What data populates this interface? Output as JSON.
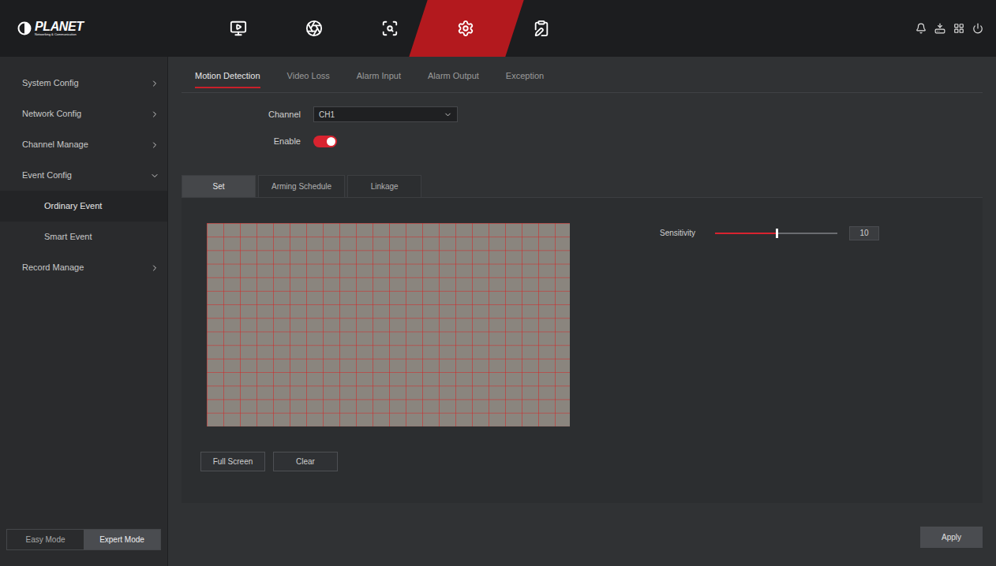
{
  "logo": {
    "name": "PLANET",
    "tagline": "Networking & Communication"
  },
  "top_nav": [
    {
      "kind": "playback",
      "selected": false
    },
    {
      "kind": "ptz",
      "selected": false
    },
    {
      "kind": "search",
      "selected": false
    },
    {
      "kind": "settings",
      "selected": true
    },
    {
      "kind": "maintenance",
      "selected": false
    }
  ],
  "top_actions": [
    {
      "kind": "alarm"
    },
    {
      "kind": "backup"
    },
    {
      "kind": "layout"
    },
    {
      "kind": "power"
    }
  ],
  "sidebar": {
    "items": [
      {
        "label": "System Config",
        "kind": "group",
        "expanded": false,
        "selected": false
      },
      {
        "label": "Network Config",
        "kind": "group",
        "expanded": false,
        "selected": false
      },
      {
        "label": "Channel Manage",
        "kind": "group",
        "expanded": false,
        "selected": false
      },
      {
        "label": "Event Config",
        "kind": "group",
        "expanded": true,
        "selected": false
      },
      {
        "label": "Ordinary Event",
        "kind": "child",
        "expanded": false,
        "selected": true
      },
      {
        "label": "Smart Event",
        "kind": "child",
        "expanded": false,
        "selected": false
      },
      {
        "label": "Record Manage",
        "kind": "group",
        "expanded": false,
        "selected": false
      }
    ]
  },
  "mode_switch": [
    {
      "label": "Easy Mode",
      "selected": false
    },
    {
      "label": "Expert Mode",
      "selected": true
    }
  ],
  "tabs": [
    {
      "label": "Motion Detection",
      "selected": true
    },
    {
      "label": "Video Loss",
      "selected": false
    },
    {
      "label": "Alarm Input",
      "selected": false
    },
    {
      "label": "Alarm Output",
      "selected": false
    },
    {
      "label": "Exception",
      "selected": false
    }
  ],
  "channel": {
    "label": "Channel",
    "value": "CH1"
  },
  "enable": {
    "label": "Enable",
    "on": true
  },
  "sub_tabs": [
    {
      "label": "Set",
      "selected": true
    },
    {
      "label": "Arming Schedule",
      "selected": false
    },
    {
      "label": "Linkage",
      "selected": false
    }
  ],
  "sensitivity": {
    "label": "Sensitivity",
    "level": 0.5,
    "value": "10"
  },
  "buttons": [
    "Full Screen",
    "Clear"
  ],
  "apply": "Apply"
}
